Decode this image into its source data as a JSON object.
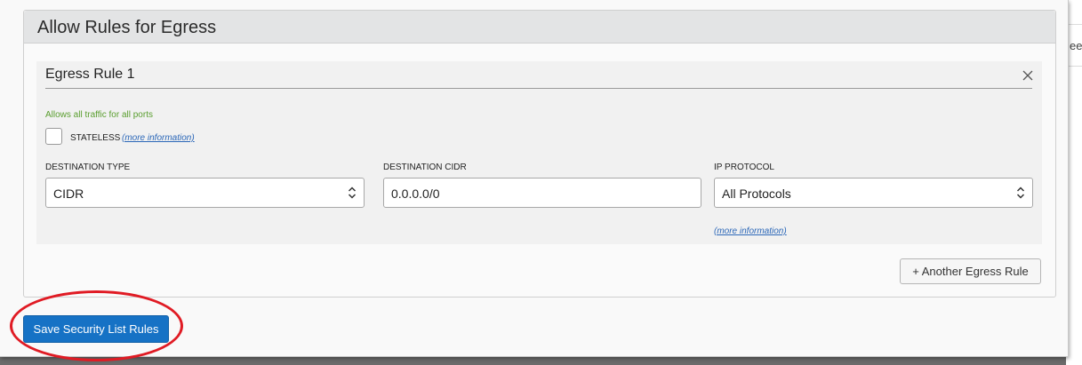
{
  "background": {
    "fragment_text": "eed"
  },
  "panel": {
    "title": "Allow Rules for Egress"
  },
  "rule": {
    "title": "Egress Rule 1",
    "hint": "Allows all traffic for all ports",
    "stateless_label": "STATELESS",
    "stateless_more": "(more information)",
    "destination_type": {
      "label": "DESTINATION TYPE",
      "value": "CIDR"
    },
    "destination_cidr": {
      "label": "DESTINATION CIDR",
      "value": "0.0.0.0/0"
    },
    "ip_protocol": {
      "label": "IP PROTOCOL",
      "value": "All Protocols",
      "more": "(more information)"
    }
  },
  "actions": {
    "add_rule_label": "+ Another Egress Rule",
    "save_label": "Save Security List Rules"
  },
  "colors": {
    "primary": "#1672c5",
    "hint": "#5a9e2f",
    "link": "#2b67b8",
    "highlight": "#e01b24"
  },
  "icons": {
    "close": "close-icon",
    "select": "chevron-up-down-icon"
  }
}
